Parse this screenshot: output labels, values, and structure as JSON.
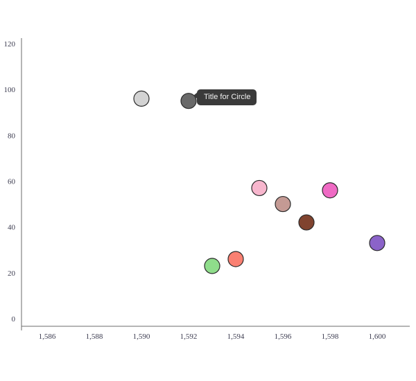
{
  "chart_data": {
    "type": "scatter",
    "title": "",
    "xlabel": "",
    "ylabel": "",
    "xlim": [
      1585,
      1601
    ],
    "ylim": [
      0,
      120
    ],
    "grid": false,
    "legend": false,
    "x_ticks": [
      "1,586",
      "1,588",
      "1,590",
      "1,592",
      "1,594",
      "1,596",
      "1,598",
      "1,600"
    ],
    "x_tick_values": [
      1586,
      1588,
      1590,
      1592,
      1594,
      1596,
      1598,
      1600
    ],
    "y_ticks": [
      "0",
      "20",
      "40",
      "60",
      "80",
      "100",
      "120"
    ],
    "y_tick_values": [
      0,
      20,
      40,
      60,
      80,
      100,
      120
    ],
    "marker_radius_px": 11,
    "marker_edge_color": "#2a2a2a",
    "points": [
      {
        "x": 1590,
        "y": 96,
        "color": "#d3d3d3",
        "name": "lightgray-point"
      },
      {
        "x": 1592,
        "y": 95,
        "color": "#696969",
        "name": "dimgray-point"
      },
      {
        "x": 1595,
        "y": 57,
        "color": "#f7b6cd",
        "name": "lightpink-point"
      },
      {
        "x": 1596,
        "y": 50,
        "color": "#c49a94",
        "name": "rosybrown-point"
      },
      {
        "x": 1597,
        "y": 42,
        "color": "#80432f",
        "name": "saddlebrown-point"
      },
      {
        "x": 1598,
        "y": 56,
        "color": "#ef6ac4",
        "name": "hotpink-point"
      },
      {
        "x": 1600,
        "y": 33,
        "color": "#8b63c9",
        "name": "mediumpurple-point"
      },
      {
        "x": 1594,
        "y": 26,
        "color": "#fa8072",
        "name": "salmon-point"
      },
      {
        "x": 1593,
        "y": 23,
        "color": "#8fdd8b",
        "name": "lightgreen-point"
      }
    ]
  },
  "tooltip": {
    "text": "Title for Circle",
    "background": "#3a3a3a",
    "text_color": "#f2f2f2",
    "anchor_point_index": 1
  },
  "axes": {
    "line_color": "#6b6b6b",
    "tick_label_color": "#3b3b4f"
  }
}
